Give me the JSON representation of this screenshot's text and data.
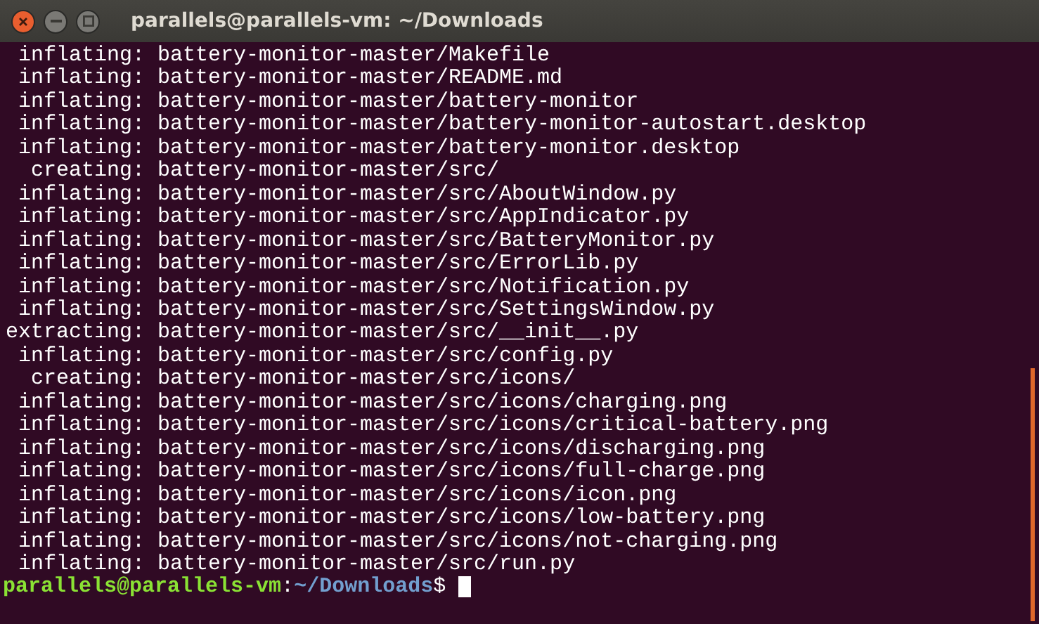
{
  "window": {
    "title": "parallels@parallels-vm: ~/Downloads"
  },
  "lines": [
    {
      "action": "inflating:",
      "path": "battery-monitor-master/Makefile"
    },
    {
      "action": "inflating:",
      "path": "battery-monitor-master/README.md"
    },
    {
      "action": "inflating:",
      "path": "battery-monitor-master/battery-monitor"
    },
    {
      "action": "inflating:",
      "path": "battery-monitor-master/battery-monitor-autostart.desktop"
    },
    {
      "action": "inflating:",
      "path": "battery-monitor-master/battery-monitor.desktop"
    },
    {
      "action": "creating:",
      "path": "battery-monitor-master/src/"
    },
    {
      "action": "inflating:",
      "path": "battery-monitor-master/src/AboutWindow.py"
    },
    {
      "action": "inflating:",
      "path": "battery-monitor-master/src/AppIndicator.py"
    },
    {
      "action": "inflating:",
      "path": "battery-monitor-master/src/BatteryMonitor.py"
    },
    {
      "action": "inflating:",
      "path": "battery-monitor-master/src/ErrorLib.py"
    },
    {
      "action": "inflating:",
      "path": "battery-monitor-master/src/Notification.py"
    },
    {
      "action": "inflating:",
      "path": "battery-monitor-master/src/SettingsWindow.py"
    },
    {
      "action": "extracting:",
      "path": "battery-monitor-master/src/__init__.py"
    },
    {
      "action": "inflating:",
      "path": "battery-monitor-master/src/config.py"
    },
    {
      "action": "creating:",
      "path": "battery-monitor-master/src/icons/"
    },
    {
      "action": "inflating:",
      "path": "battery-monitor-master/src/icons/charging.png"
    },
    {
      "action": "inflating:",
      "path": "battery-monitor-master/src/icons/critical-battery.png"
    },
    {
      "action": "inflating:",
      "path": "battery-monitor-master/src/icons/discharging.png"
    },
    {
      "action": "inflating:",
      "path": "battery-monitor-master/src/icons/full-charge.png"
    },
    {
      "action": "inflating:",
      "path": "battery-monitor-master/src/icons/icon.png"
    },
    {
      "action": "inflating:",
      "path": "battery-monitor-master/src/icons/low-battery.png"
    },
    {
      "action": "inflating:",
      "path": "battery-monitor-master/src/icons/not-charging.png"
    },
    {
      "action": "inflating:",
      "path": "battery-monitor-master/src/run.py"
    }
  ],
  "prompt": {
    "user_host": "parallels@parallels-vm",
    "separator": ":",
    "cwd": "~/Downloads",
    "symbol": "$"
  }
}
